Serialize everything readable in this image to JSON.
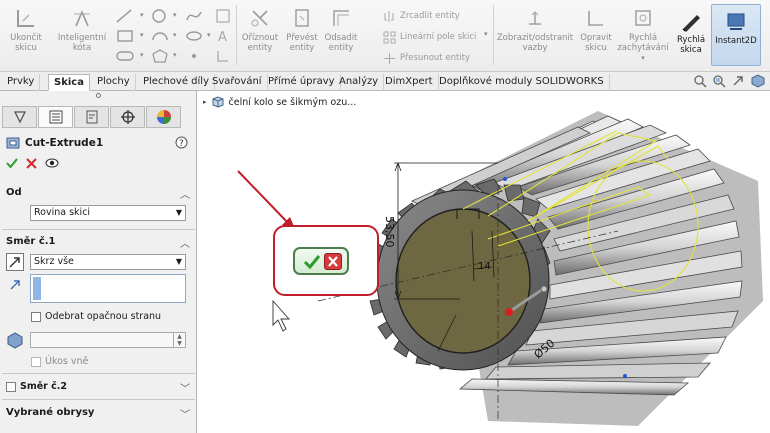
{
  "ribbon": {
    "ukoncit_skicu": "Ukončit skicu",
    "inteligentni_kota": "Inteligentní kóta",
    "oriznout_entity": "Oříznout entity",
    "prevest_entity": "Převést entity",
    "odsadit_entity": "Odsadit entity",
    "zrcadlit_entity": "Zrcadlit entity",
    "linearni_pole_skici": "Lineární pole skici",
    "presunout_entity": "Přesunout entity",
    "zobrazit_odstranit_vazby": "Zobrazit/odstranit vazby",
    "opravit_skicu": "Opravit skicu",
    "rychla_zachytavani": "Rychlá zachytávání",
    "rychla_skica": "Rychlá skica",
    "instant2d": "Instant2D"
  },
  "tabs": [
    "Prvky",
    "Skica",
    "Plochy",
    "Plechové díly",
    "Svařování",
    "Přímé úpravy",
    "Analýzy",
    "DimXpert",
    "Doplňkové moduly SOLIDWORKS"
  ],
  "active_tab": "Skica",
  "property_manager": {
    "feature_title": "Cut-Extrude1",
    "od_label": "Od",
    "od_value": "Rovina skici",
    "smer1_label": "Směr č.1",
    "smer1_value": "Skrz vše",
    "odebrat_label": "Odebrat opačnou stranu",
    "ukos_label": "Úkos vně",
    "smer2_label": "Směr č.2",
    "vybrane_label": "Vybrané obrysy"
  },
  "tree": {
    "part_name": "čelní kolo se šikmým ozu..."
  },
  "model": {
    "dim_height": "53,50",
    "dim_keyway": "14",
    "dim_diameter": "Ø50"
  },
  "colors": {
    "accent_red": "#c01e2a",
    "ok_green": "#2f9a2f",
    "sketch_yellow": "#e2e23a"
  }
}
